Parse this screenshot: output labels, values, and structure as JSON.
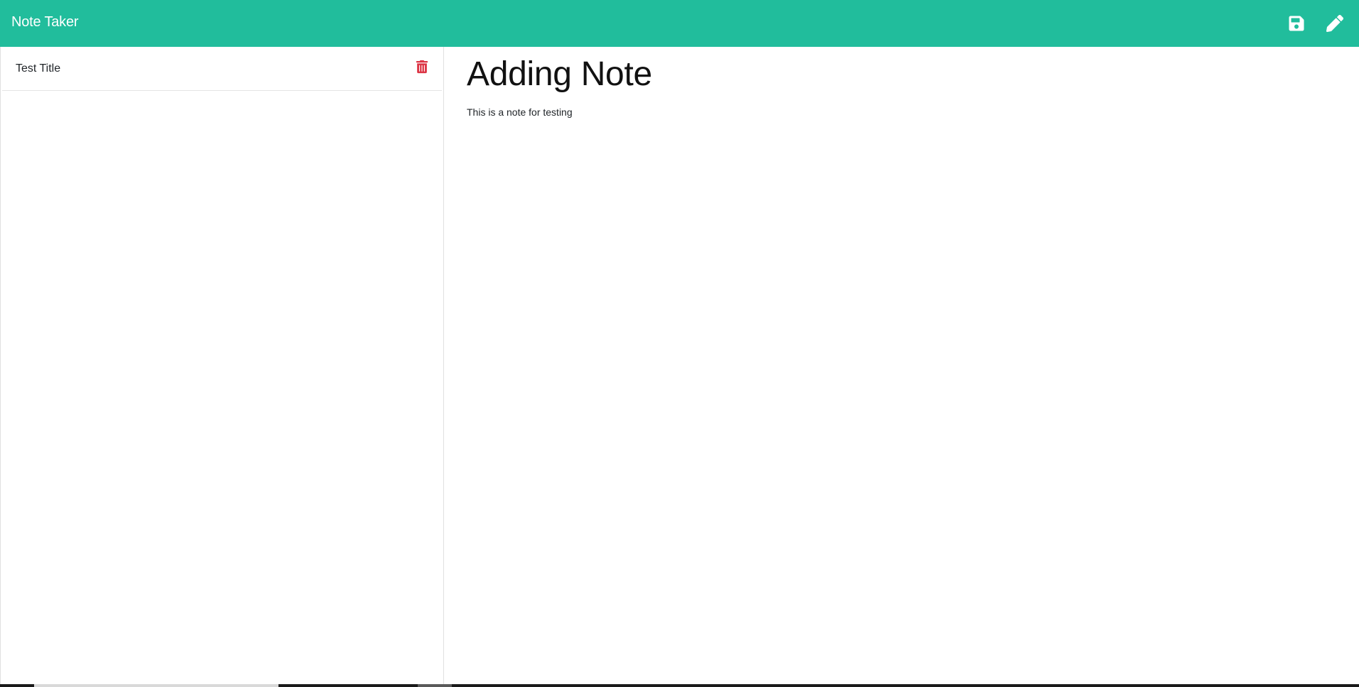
{
  "navbar": {
    "brand": "Note Taker",
    "icons": [
      "save-icon",
      "pencil-icon"
    ],
    "accent_color": "#21bd9c"
  },
  "sidebar": {
    "notes": [
      {
        "title": "Test Title",
        "delete_icon": "trash-icon",
        "delete_color": "#dc3545"
      }
    ]
  },
  "editor": {
    "title_value": "Adding Note",
    "body_value": "This is a note for testing"
  }
}
